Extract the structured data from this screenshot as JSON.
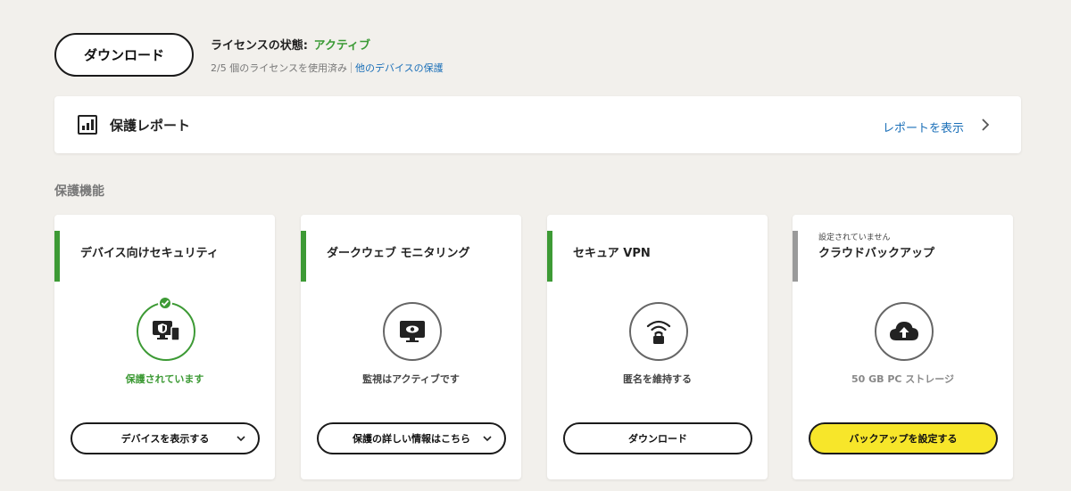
{
  "top": {
    "download_label": "ダウンロード",
    "license_label": "ライセンスの状態:",
    "license_status": "アクティブ",
    "license_usage": "2/5 個のライセンスを使用済み",
    "protect_other_link": "他のデバイスの保護"
  },
  "report": {
    "title": "保護レポート",
    "link": "レポートを表示"
  },
  "section_title": "保護機能",
  "cards": [
    {
      "title": "デバイス向けセキュリティ",
      "status": "保護されています",
      "button": "デバイスを表示する",
      "icon": "device-shield-icon"
    },
    {
      "title": "ダークウェブ モニタリング",
      "status": "監視はアクティブです",
      "button": "保護の詳しい情報はこちら",
      "icon": "monitor-eye-icon"
    },
    {
      "title": "セキュア VPN",
      "status": "匿名を維持する",
      "button": "ダウンロード",
      "icon": "wifi-lock-icon"
    },
    {
      "note": "設定されていません",
      "title": "クラウドバックアップ",
      "status": "50 GB PC ストレージ",
      "button": "バックアップを設定する",
      "icon": "cloud-upload-icon"
    }
  ],
  "colors": {
    "background": "#f2f0ec",
    "accent_green": "#3d9a35",
    "link_blue": "#1a6fb8",
    "cta_yellow": "#f7e62a",
    "inactive_grey": "#9a9a9a"
  }
}
